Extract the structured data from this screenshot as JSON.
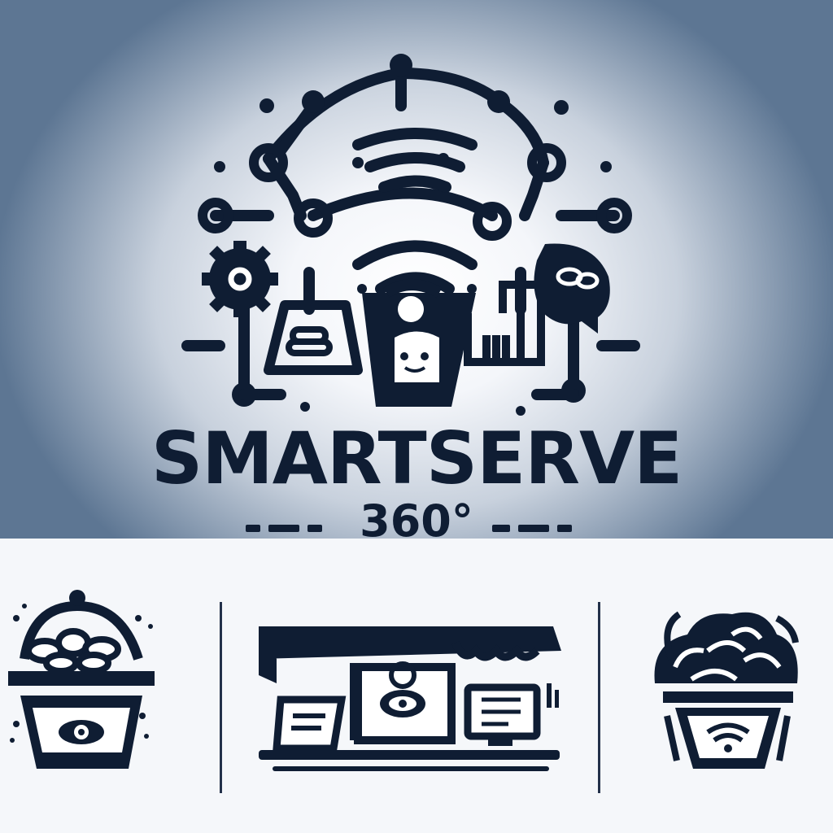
{
  "brand": {
    "name": "SMARTSERVE",
    "subtitle": "360°"
  },
  "icons": {
    "header_network": "network-dome-icon",
    "wifi": "wifi-icon",
    "gear": "gear-icon",
    "chat": "chat-bubble-icon",
    "order_bag": "order-bag-icon",
    "smart_cup": "smart-cup-icon",
    "fork_menu": "fork-menu-icon",
    "food_bowl_eye": "food-bowl-eye-icon",
    "smart_kiosk": "smart-kiosk-icon",
    "food_bowl_wifi": "food-bowl-wifi-icon"
  },
  "colors": {
    "ink": "#0f1d33",
    "background_top": "#5d7693",
    "background_center": "#ffffff",
    "background_bottom": "#f5f7fa"
  }
}
